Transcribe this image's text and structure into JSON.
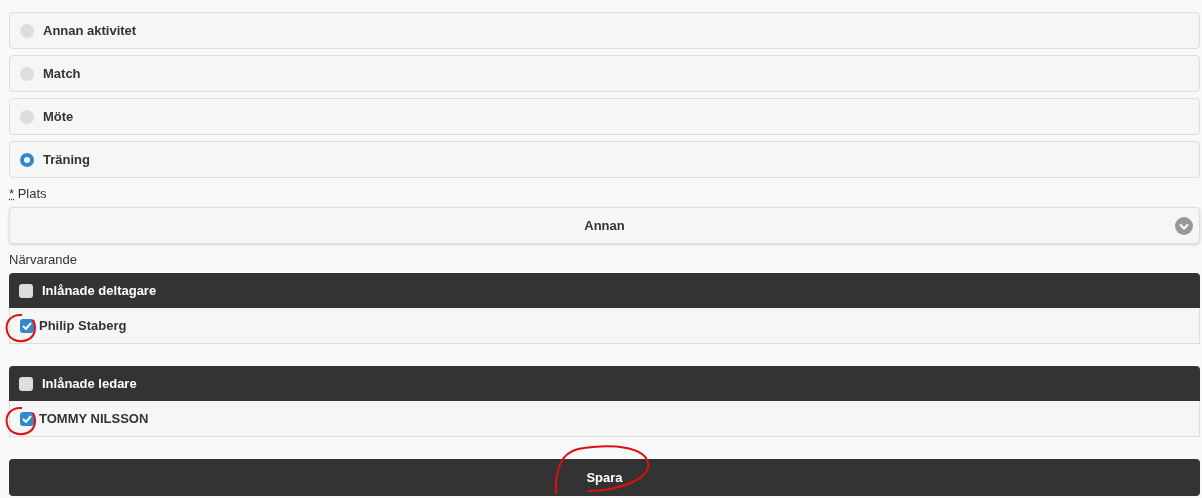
{
  "activity_types": [
    {
      "label": "Annan aktivitet",
      "selected": false
    },
    {
      "label": "Match",
      "selected": false
    },
    {
      "label": "Möte",
      "selected": false
    },
    {
      "label": "Träning",
      "selected": true
    }
  ],
  "place": {
    "required_mark": "*",
    "label": "Plats",
    "value": "Annan"
  },
  "attendance": {
    "label": "Närvarande",
    "groups": [
      {
        "title": "Inlånade deltagare",
        "checked": false,
        "members": [
          {
            "name": "Philip Staberg",
            "checked": true,
            "circled": true
          }
        ]
      },
      {
        "title": "Inlånade ledare",
        "checked": false,
        "members": [
          {
            "name": "TOMMY NILSSON",
            "checked": true,
            "circled": true
          }
        ]
      }
    ]
  },
  "save_button": {
    "label": "Spara",
    "circled": true
  }
}
